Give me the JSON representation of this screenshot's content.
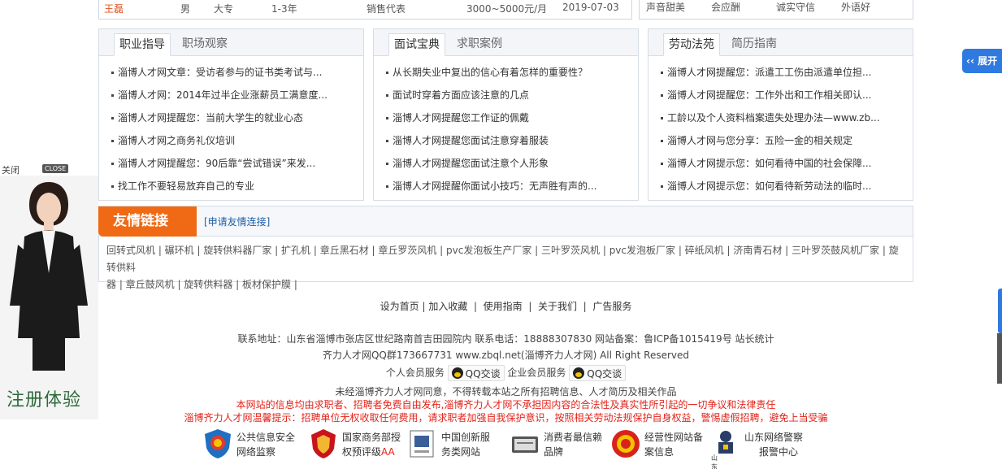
{
  "top_row": {
    "name": "王磊",
    "gender": "男",
    "education": "大专",
    "experience": "1-3年",
    "position": "销售代表",
    "salary": "3000~5000元/月",
    "date": "2019-07-03"
  },
  "top_right_tags": [
    "声音甜美",
    "会应酬",
    "诚实守信",
    "外语好"
  ],
  "panels": [
    {
      "tabs": [
        "职业指导",
        "职场观察"
      ],
      "items": [
        "淄博人才网文章：受访者参与的证书类考试与...",
        "淄博人才网：2014年过半企业涨薪员工满意度...",
        "淄博人才网提醒您：当前大学生的就业心态",
        "淄博人才网之商务礼仪培训",
        "淄博人才网提醒您：90后靠“尝试错误”来发...",
        "找工作不要轻易放弃自己的专业"
      ]
    },
    {
      "tabs": [
        "面试宝典",
        "求职案例"
      ],
      "items": [
        "从长期失业中复出的信心有着怎样的重要性？",
        "面试时穿着方面应该注意的几点",
        "淄博人才网提醒您工作证的佩戴",
        "淄博人才网提醒您面试注意穿着服装",
        "淄博人才网提醒您面试注意个人形象",
        "淄博人才网提醒你面试小技巧：无声胜有声的..."
      ]
    },
    {
      "tabs": [
        "劳动法苑",
        "简历指南"
      ],
      "items": [
        "淄博人才网提醒您：派遣工工伤由派遣单位担...",
        "淄博人才网提醒您：工作外出和工作相关即认...",
        "工龄以及个人资料档案遗失处理办法—www.zb...",
        "淄博人才网与您分享：五险一金的相关规定",
        "淄博人才网提示您：如何看待中国的社会保障...",
        "淄博人才网提示您：如何看待新劳动法的临时..."
      ]
    }
  ],
  "friends": {
    "title": "友情链接",
    "apply": "[申请友情连接]",
    "links_line1": "回转式风机 | 碾环机 | 旋转供料器厂家 | 扩孔机 | 章丘黑石材 | 章丘罗茨风机 | pvc发泡板生产厂家 | 三叶罗茨风机 | pvc发泡板厂家 | 碎纸风机 | 济南青石材 | 三叶罗茨鼓风机厂家 | 旋转供料",
    "links_line2": "器 | 章丘鼓风机 | 旋转供料器 | 板材保护膜 |"
  },
  "footer": {
    "nav": [
      "设为首页",
      "加入收藏",
      "使用指南",
      "关于我们",
      "广告服务"
    ],
    "address": "联系地址：山东省淄博市张店区世纪路南首吉田园院内 联系电话：18888307830 网站备案：鲁ICP备1015419号 站长统计",
    "copyright": "齐力人才网QQ群173667731 www.zbql.net(淄博齐力人才网) All Right Reserved",
    "personal_service": "个人会员服务",
    "enterprise_service": "企业会员服务",
    "qq_label": "QQ交谈",
    "notice": "未经淄博齐力人才网同意，不得转载本站之所有招聘信息、人才简历及相关作品",
    "disclaimer": "本网站的信息均由求职者、招聘者免费自由发布,淄博齐力人才网不承担因内容的合法性及真实性所引起的一切争议和法律责任",
    "warning": "淄博齐力人才网温馨提示：招聘单位无权收取任何费用，请求职者加强自我保护意识，按照相关劳动法规保护自身权益，警惕虚假招聘，避免上当受骗"
  },
  "certs": [
    {
      "line1": "公共信息安全",
      "line2": "网络监察"
    },
    {
      "line1": "国家商务部授",
      "line2": "权预评级",
      "line2_red": "AA"
    },
    {
      "line1": "中国创新服",
      "line2": "务类网站"
    },
    {
      "line1": "消费者最信赖",
      "line2": "品牌"
    },
    {
      "line1": "经营性网站备",
      "line2": "案信息"
    },
    {
      "line1": "山东网络警察",
      "line2": "报警中心",
      "icon_text": "山东警察"
    }
  ],
  "side_ad": {
    "close_text": "关闭",
    "close_btn": "CLOSE",
    "caption": "注册体验"
  },
  "expand_btn": "展开",
  "colors": {
    "accent_orange": "#f06a15",
    "link_blue": "#1f5ea8",
    "red": "#e2231a",
    "expand_blue": "#2f7ae0"
  }
}
